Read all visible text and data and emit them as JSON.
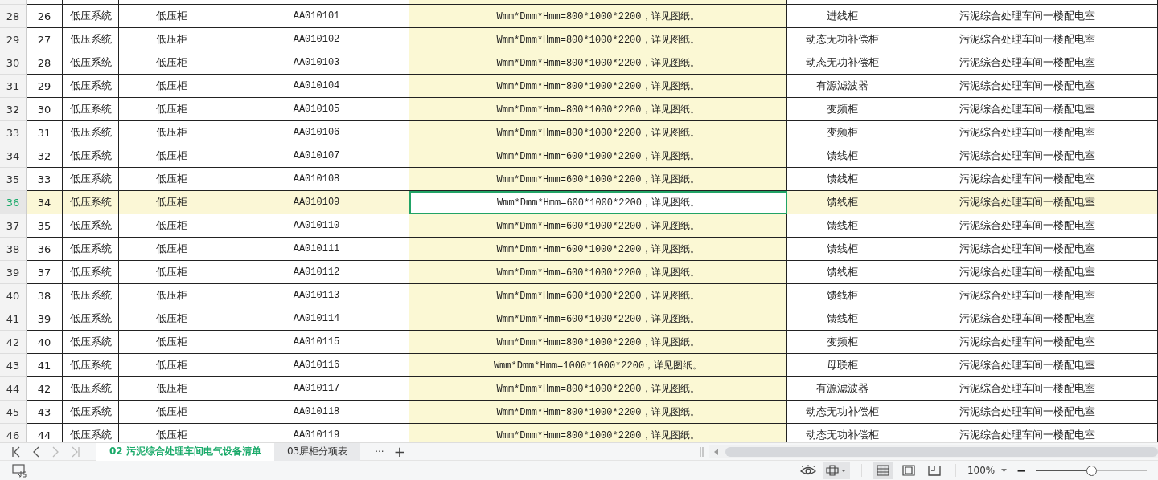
{
  "rows": [
    {
      "row": "28",
      "no": "26",
      "system": "低压系统",
      "type": "低压柜",
      "code": "AA010101",
      "spec": "Wmm*Dmm*Hmm=800*1000*2200，详见图纸。",
      "name": "进线柜",
      "location": "污泥综合处理车间一楼配电室",
      "selected": false
    },
    {
      "row": "29",
      "no": "27",
      "system": "低压系统",
      "type": "低压柜",
      "code": "AA010102",
      "spec": "Wmm*Dmm*Hmm=800*1000*2200，详见图纸。",
      "name": "动态无功补偿柜",
      "location": "污泥综合处理车间一楼配电室",
      "selected": false
    },
    {
      "row": "30",
      "no": "28",
      "system": "低压系统",
      "type": "低压柜",
      "code": "AA010103",
      "spec": "Wmm*Dmm*Hmm=800*1000*2200，详见图纸。",
      "name": "动态无功补偿柜",
      "location": "污泥综合处理车间一楼配电室",
      "selected": false
    },
    {
      "row": "31",
      "no": "29",
      "system": "低压系统",
      "type": "低压柜",
      "code": "AA010104",
      "spec": "Wmm*Dmm*Hmm=800*1000*2200，详见图纸。",
      "name": "有源滤波器",
      "location": "污泥综合处理车间一楼配电室",
      "selected": false
    },
    {
      "row": "32",
      "no": "30",
      "system": "低压系统",
      "type": "低压柜",
      "code": "AA010105",
      "spec": "Wmm*Dmm*Hmm=800*1000*2200，详见图纸。",
      "name": "变频柜",
      "location": "污泥综合处理车间一楼配电室",
      "selected": false
    },
    {
      "row": "33",
      "no": "31",
      "system": "低压系统",
      "type": "低压柜",
      "code": "AA010106",
      "spec": "Wmm*Dmm*Hmm=800*1000*2200，详见图纸。",
      "name": "变频柜",
      "location": "污泥综合处理车间一楼配电室",
      "selected": false
    },
    {
      "row": "34",
      "no": "32",
      "system": "低压系统",
      "type": "低压柜",
      "code": "AA010107",
      "spec": "Wmm*Dmm*Hmm=600*1000*2200，详见图纸。",
      "name": "馈线柜",
      "location": "污泥综合处理车间一楼配电室",
      "selected": false
    },
    {
      "row": "35",
      "no": "33",
      "system": "低压系统",
      "type": "低压柜",
      "code": "AA010108",
      "spec": "Wmm*Dmm*Hmm=600*1000*2200，详见图纸。",
      "name": "馈线柜",
      "location": "污泥综合处理车间一楼配电室",
      "selected": false
    },
    {
      "row": "36",
      "no": "34",
      "system": "低压系统",
      "type": "低压柜",
      "code": "AA010109",
      "spec": "Wmm*Dmm*Hmm=600*1000*2200，详见图纸。",
      "name": "馈线柜",
      "location": "污泥综合处理车间一楼配电室",
      "selected": true
    },
    {
      "row": "37",
      "no": "35",
      "system": "低压系统",
      "type": "低压柜",
      "code": "AA010110",
      "spec": "Wmm*Dmm*Hmm=600*1000*2200，详见图纸。",
      "name": "馈线柜",
      "location": "污泥综合处理车间一楼配电室",
      "selected": false
    },
    {
      "row": "38",
      "no": "36",
      "system": "低压系统",
      "type": "低压柜",
      "code": "AA010111",
      "spec": "Wmm*Dmm*Hmm=600*1000*2200，详见图纸。",
      "name": "馈线柜",
      "location": "污泥综合处理车间一楼配电室",
      "selected": false
    },
    {
      "row": "39",
      "no": "37",
      "system": "低压系统",
      "type": "低压柜",
      "code": "AA010112",
      "spec": "Wmm*Dmm*Hmm=600*1000*2200，详见图纸。",
      "name": "馈线柜",
      "location": "污泥综合处理车间一楼配电室",
      "selected": false
    },
    {
      "row": "40",
      "no": "38",
      "system": "低压系统",
      "type": "低压柜",
      "code": "AA010113",
      "spec": "Wmm*Dmm*Hmm=600*1000*2200，详见图纸。",
      "name": "馈线柜",
      "location": "污泥综合处理车间一楼配电室",
      "selected": false
    },
    {
      "row": "41",
      "no": "39",
      "system": "低压系统",
      "type": "低压柜",
      "code": "AA010114",
      "spec": "Wmm*Dmm*Hmm=600*1000*2200，详见图纸。",
      "name": "馈线柜",
      "location": "污泥综合处理车间一楼配电室",
      "selected": false
    },
    {
      "row": "42",
      "no": "40",
      "system": "低压系统",
      "type": "低压柜",
      "code": "AA010115",
      "spec": "Wmm*Dmm*Hmm=800*1000*2200，详见图纸。",
      "name": "变频柜",
      "location": "污泥综合处理车间一楼配电室",
      "selected": false
    },
    {
      "row": "43",
      "no": "41",
      "system": "低压系统",
      "type": "低压柜",
      "code": "AA010116",
      "spec": "Wmm*Dmm*Hmm=1000*1000*2200，详见图纸。",
      "name": "母联柜",
      "location": "污泥综合处理车间一楼配电室",
      "selected": false
    },
    {
      "row": "44",
      "no": "42",
      "system": "低压系统",
      "type": "低压柜",
      "code": "AA010117",
      "spec": "Wmm*Dmm*Hmm=800*1000*2200，详见图纸。",
      "name": "有源滤波器",
      "location": "污泥综合处理车间一楼配电室",
      "selected": false
    },
    {
      "row": "45",
      "no": "43",
      "system": "低压系统",
      "type": "低压柜",
      "code": "AA010118",
      "spec": "Wmm*Dmm*Hmm=800*1000*2200，详见图纸。",
      "name": "动态无功补偿柜",
      "location": "污泥综合处理车间一楼配电室",
      "selected": false
    },
    {
      "row": "46",
      "no": "44",
      "system": "低压系统",
      "type": "低压柜",
      "code": "AA010119",
      "spec": "Wmm*Dmm*Hmm=800*1000*2200，详见图纸。",
      "name": "动态无功补偿柜",
      "location": "污泥综合处理车间一楼配电室",
      "selected": false
    }
  ],
  "sheet_tabs": [
    {
      "label": "02 污泥综合处理车间电气设备清单",
      "selected": true
    },
    {
      "label": "03屏柜分项表",
      "selected": false
    }
  ],
  "more_tabs": "···",
  "add_tab": "+",
  "status_bar": {
    "views": [
      {
        "kind": "normal",
        "selected": true
      },
      {
        "kind": "page-break",
        "selected": false
      },
      {
        "kind": "page-layout",
        "selected": false
      }
    ],
    "zoom": "100%",
    "zoom_out": "−",
    "level": 0.5
  }
}
